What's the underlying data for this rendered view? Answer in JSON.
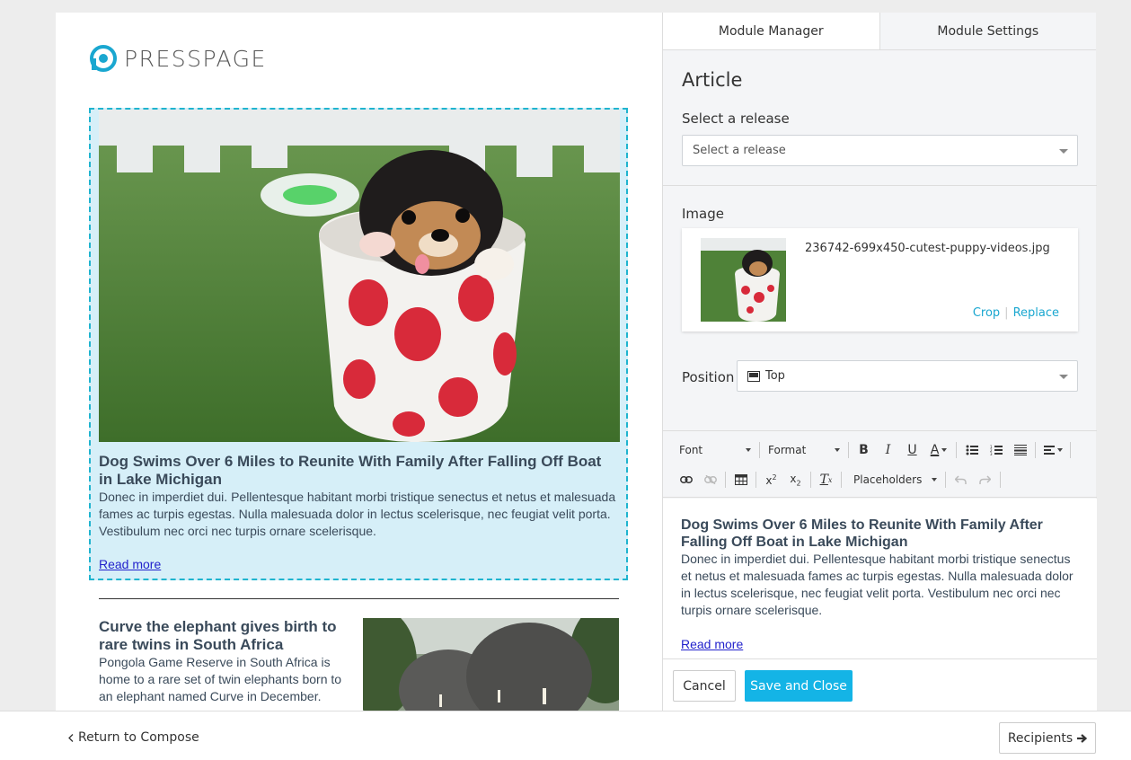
{
  "brand": {
    "logo_text": "PRESSPAGE",
    "accent": "#14b4e6"
  },
  "preview": {
    "selected_article": {
      "title": "Dog Swims Over 6 Miles to Reunite With Family After Falling Off Boat in Lake Michigan",
      "body": "Donec in imperdiet dui. Pellentesque habitant morbi tristique senectus et netus et malesuada fames ac turpis egestas. Nulla malesuada dolor in lectus scelerisque, nec feugiat velit porta. Vestibulum nec orci nec turpis ornare scelerisque.",
      "link": "Read more",
      "highlight_color": "#d6eff8"
    },
    "second_article": {
      "title": "Curve the elephant gives birth to rare twins in South Africa",
      "body": "Pongola Game Reserve in South Africa is home to a rare set of twin elephants born to an elephant named Curve in December."
    }
  },
  "panel": {
    "tabs": [
      {
        "label": "Module Manager",
        "active": true
      },
      {
        "label": "Module Settings",
        "active": false
      }
    ],
    "section_title": "Article",
    "release": {
      "label": "Select a release",
      "placeholder": "Select a release"
    },
    "image": {
      "label": "Image",
      "filename": "236742-699x450-cutest-puppy-videos.jpg",
      "crop_label": "Crop",
      "replace_label": "Replace"
    },
    "position": {
      "label": "Position",
      "value": "Top"
    },
    "toolbar": {
      "font_label": "Font",
      "format_label": "Format",
      "placeholders_label": "Placeholders"
    },
    "editor": {
      "title": "Dog Swims Over 6 Miles to Reunite With Family After Falling Off Boat in Lake Michigan",
      "body": "Donec in imperdiet dui. Pellentesque habitant morbi tristique senectus et netus et malesuada fames ac turpis egestas. Nulla malesuada dolor in lectus scelerisque, nec feugiat velit porta. Vestibulum nec orci nec turpis ornare scelerisque.",
      "link": "Read more"
    },
    "actions": {
      "cancel_label": "Cancel",
      "save_label": "Save and Close"
    }
  },
  "footer": {
    "return_label": "Return to Compose",
    "recipients_label": "Recipients"
  }
}
